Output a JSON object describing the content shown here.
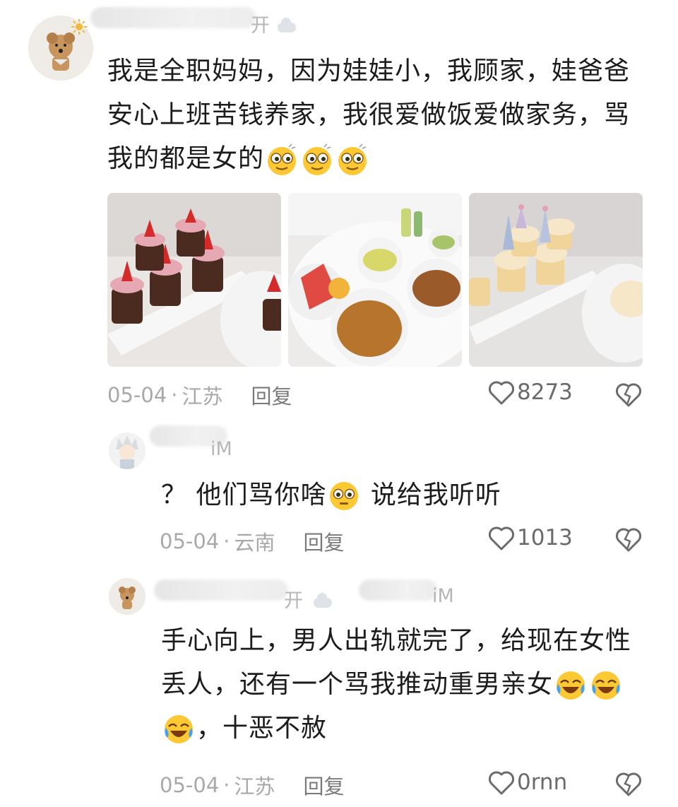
{
  "comments": [
    {
      "author_suffix": "开",
      "text_lines": [
        "我是全职妈妈，因为娃娃小，我顾家，娃爸爸",
        "安心上班苦钱养家，我很爱做饭爱做家务，骂",
        "我的都是女的"
      ],
      "date": "05-04",
      "location": "江苏",
      "reply_label": "回复",
      "likes": "8273",
      "photos": [
        "cupcakes-chocolate-photo",
        "dinner-plates-photo",
        "cupcakes-party-photo"
      ]
    },
    {
      "author_suffix": "iM",
      "text": "？ 他们骂你啥",
      "text_after": " 说给我听听",
      "date": "05-04",
      "location": "云南",
      "reply_label": "回复",
      "likes": "1013"
    },
    {
      "author_suffix_a": "开",
      "author_suffix_b": "iM",
      "text_line1": "手心向上，男人出轨就完了，给现在女性",
      "text_line2": "丢人，还有一个骂我推动重男亲女",
      "text_line3": "，十恶不赦",
      "date": "05-04",
      "location": "江苏",
      "reply_label": "回复",
      "likes": "0rnn"
    }
  ],
  "meta_separator": "·",
  "colors": {
    "text": "#1c1c1c",
    "meta": "#a9a9a9",
    "icon": "#6b6b6b"
  }
}
